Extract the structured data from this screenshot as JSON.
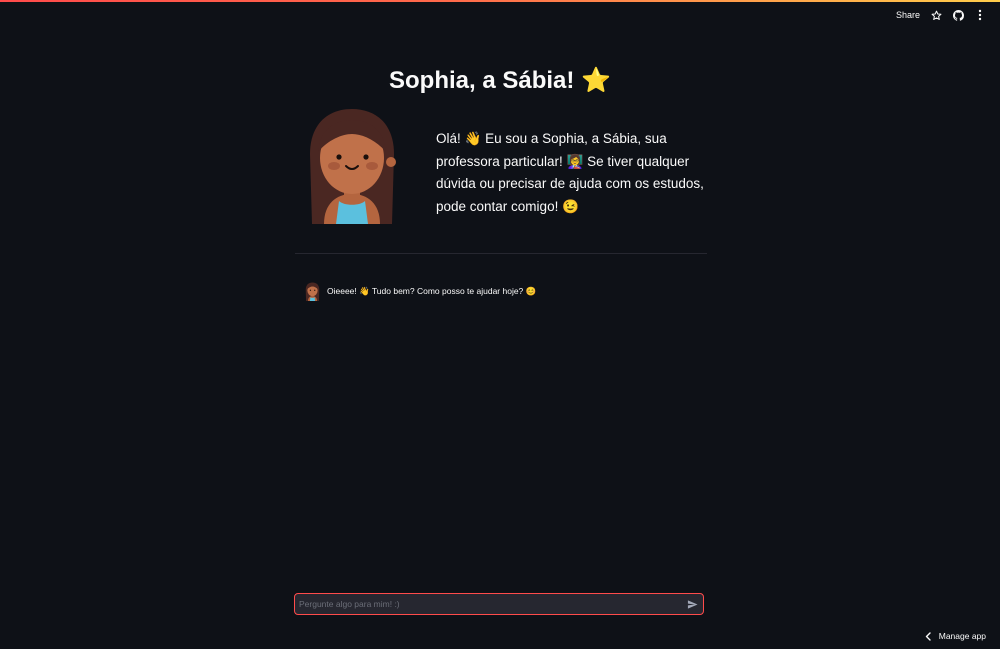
{
  "header": {
    "share_label": "Share",
    "icons": [
      "star-icon",
      "github-icon",
      "kebab-menu-icon"
    ],
    "accent_gradient": [
      "#ff4b4b",
      "#ffcd4b"
    ]
  },
  "main": {
    "title": "Sophia, a Sábia!",
    "title_emoji": "⭐",
    "intro": "Olá! 👋 Eu sou a Sophia, a Sábia, sua professora particular! 👩‍🏫 Se tiver qualquer dúvida ou precisar de ajuda com os estudos, pode contar comigo! 😉"
  },
  "chat": {
    "messages": [
      {
        "role": "assistant",
        "text": "Oieeee! 👋 Tudo bem? Como posso te ajudar hoje? 😊"
      }
    ],
    "input_placeholder": "Pergunte algo para mim! :)"
  },
  "footer": {
    "manage_label": "Manage app"
  },
  "colors": {
    "background": "#0e1117",
    "input_bg": "#262730",
    "input_border": "#ff4b4b",
    "text": "#fafafa"
  }
}
